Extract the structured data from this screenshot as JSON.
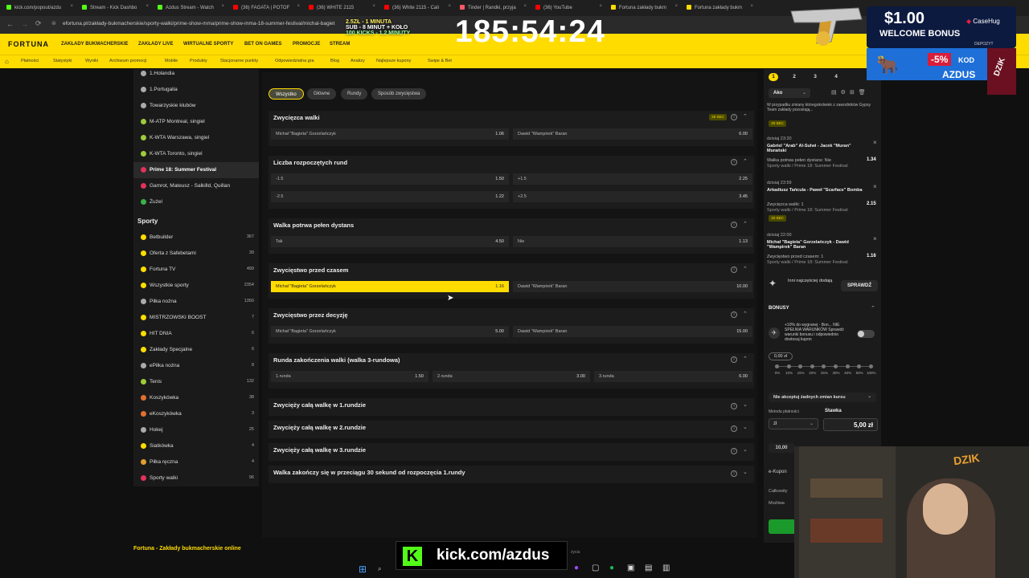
{
  "browser": {
    "tabs": [
      {
        "label": "kick.com/popout/azdu",
        "color": "#53fc18"
      },
      {
        "label": "Stream - Kick Dashbo",
        "color": "#53fc18"
      },
      {
        "label": "Azdus Stream - Watch",
        "color": "#53fc18"
      },
      {
        "label": "(36) FAGATA | POTOF",
        "color": "#ff0000"
      },
      {
        "label": "(36) WHITE 2115",
        "color": "#ff0000"
      },
      {
        "label": "(36) White 2115 - Cali",
        "color": "#ff0000"
      },
      {
        "label": "Tinder | Randki, przyja",
        "color": "#ff5864"
      },
      {
        "label": "(36) YouTube",
        "color": "#ff0000"
      },
      {
        "label": "Fortuna zakłady bukm",
        "color": "#ffdc00"
      },
      {
        "label": "Fortuna zakłady bukm",
        "color": "#ffdc00"
      }
    ],
    "url": "efortuna.pl/zakłady-bukmacherskie/sporty-walki/prime-show-mma/prime-show-mma-18-summer-festival/michal-bagiet"
  },
  "site": {
    "logo": "FORTUNA",
    "nav": [
      "ZAKŁADY BUKMACHERSKIE",
      "ZAKŁADY LIVE",
      "WIRTUALNE SPORTY",
      "BET ON GAMES",
      "PROMOCJE",
      "STREAM"
    ],
    "subnav": [
      "Płatności",
      "Statystyki",
      "Wyniki",
      "Archiwum promocji",
      "Mobile",
      "Produkty",
      "Stacjonarne punkty",
      "Odpowiedzialna gra",
      "Blog",
      "Analizy",
      "Najlepsze kupony",
      "Swipe & Bet"
    ]
  },
  "sidebar": {
    "top_items": [
      {
        "label": "1.Holandia",
        "icon": "soccer-ball",
        "color": "#aaaaaa"
      },
      {
        "label": "1.Portugalia",
        "icon": "soccer-ball",
        "color": "#aaaaaa"
      },
      {
        "label": "Towarzyskie klubów",
        "icon": "soccer-ball",
        "color": "#aaaaaa"
      },
      {
        "label": "M-ATP Montreal, singiel",
        "icon": "tennis-ball",
        "color": "#9ccc3a"
      },
      {
        "label": "K-WTA Warszawa, singiel",
        "icon": "tennis-ball",
        "color": "#9ccc3a"
      },
      {
        "label": "K-WTA Toronto, singiel",
        "icon": "tennis-ball",
        "color": "#9ccc3a"
      },
      {
        "label": "Prime 18: Summer Festival",
        "icon": "fight-glove",
        "color": "#e0325a",
        "selected": true
      },
      {
        "label": "Gamrot, Mateusz - Salkilld, Quillan",
        "icon": "fight-glove",
        "color": "#e0325a"
      },
      {
        "label": "Żużel",
        "icon": "speedway",
        "color": "#3ab24a"
      }
    ],
    "section_title": "Sporty",
    "sports": [
      {
        "label": "Betbuilder",
        "count": "367",
        "color": "#ffdc00"
      },
      {
        "label": "Oferta z Safebetami",
        "count": "39",
        "color": "#ffdc00"
      },
      {
        "label": "Fortuna TV",
        "count": "499",
        "color": "#ffdc00"
      },
      {
        "label": "Wszystkie sporty",
        "count": "2354",
        "color": "#ffdc00"
      },
      {
        "label": "Piłka nożna",
        "count": "1350",
        "color": "#aaaaaa"
      },
      {
        "label": "MISTRZOWSKI BOOST",
        "count": "7",
        "color": "#ffdc00"
      },
      {
        "label": "HIT DNIA",
        "count": "6",
        "color": "#ffdc00"
      },
      {
        "label": "Zakłady Specjalne",
        "count": "6",
        "color": "#ffdc00"
      },
      {
        "label": "ePiłka nożna",
        "count": "8",
        "color": "#aaaaaa"
      },
      {
        "label": "Tenis",
        "count": "132",
        "color": "#9ccc3a"
      },
      {
        "label": "Koszykówka",
        "count": "38",
        "color": "#e07030"
      },
      {
        "label": "eKoszykówka",
        "count": "3",
        "color": "#e07030"
      },
      {
        "label": "Hokej",
        "count": "25",
        "color": "#aaaaaa"
      },
      {
        "label": "Siatkówka",
        "count": "4",
        "color": "#ffdc00"
      },
      {
        "label": "Piłka ręczna",
        "count": "4",
        "color": "#e0a030"
      },
      {
        "label": "Sporty walki",
        "count": "96",
        "color": "#e0325a"
      }
    ]
  },
  "filters": [
    "Wszystko",
    "Główne",
    "Rundy",
    "Sposób zwycięstwa"
  ],
  "markets": {
    "m1": {
      "title": "Zwycięzca walki",
      "badge": "20 SEC",
      "a_name": "Michał \"Bagieta\" Gorzelańczyk",
      "a_odd": "1.06",
      "b_name": "Dawid \"Wampirek\" Baran",
      "b_odd": "6.00"
    },
    "m2": {
      "title": "Liczba rozpoczętych rund",
      "r1a": "-1.5",
      "r1a_odd": "1.50",
      "r1b": "+1.5",
      "r1b_odd": "2.25",
      "r2a": "-2.5",
      "r2a_odd": "1.22",
      "r2b": "+2.5",
      "r2b_odd": "3.45"
    },
    "m3": {
      "title": "Walka potrwa pełen dystans",
      "a_name": "Tak",
      "a_odd": "4.50",
      "b_name": "Nie",
      "b_odd": "1.13"
    },
    "m4": {
      "title": "Zwycięstwo przed czasem",
      "a_name": "Michał \"Bagieta\" Gorzelańczyk",
      "a_odd": "1.16",
      "b_name": "Dawid \"Wampirek\" Baran",
      "b_odd": "10.00"
    },
    "m5": {
      "title": "Zwycięstwo przez decyzję",
      "a_name": "Michał \"Bagieta\" Gorzelańczyk",
      "a_odd": "5.00",
      "b_name": "Dawid \"Wampirek\" Baran",
      "b_odd": "15.00"
    },
    "m6": {
      "title": "Runda zakończenia walki (walka 3-rundowa)",
      "a_name": "1.runda",
      "a_odd": "1.50",
      "b_name": "2.runda",
      "b_odd": "3.00",
      "c_name": "3.runda",
      "c_odd": "6.00"
    },
    "collapsed": [
      "Zwycięży całą walkę w 1.rundzie",
      "Zwycięży całą walkę w 2.rundzie",
      "Zwycięży całą walkę w 3.rundzie",
      "Walka zakończy się w przeciągu 30 sekund od rozpoczęcia 1.rundy"
    ]
  },
  "betslip": {
    "tabs": [
      "1",
      "2",
      "3",
      "4"
    ],
    "type": "Ako",
    "notice": "W przypadku zmiany któregokolwiek z zawodników Gypsy Team zakłady pozostają...",
    "notice_badge": "20 SEC",
    "bets": [
      {
        "time": "dzisiaj 23:20",
        "match": "Gabriel \"Arab\" Al-Sulwi - Jacek \"Muran\" Murański",
        "market": "Walka potrwa pełen dystans: Nie",
        "event": "Sporty walki / Prime 18: Summer Festival",
        "odd": "1.34"
      },
      {
        "time": "dzisiaj 23:59",
        "match": "Arkadiusz Tańcula - Paweł \"Scarface\" Bomba",
        "market": "Zwycięzca walki: 1",
        "event": "Sporty walki / Prime 18: Summer Festival",
        "odd": "2.15",
        "badge": "20 SEC"
      },
      {
        "time": "dzisiaj 22:00",
        "match": "Michał \"Bagieta\" Gorzelańczyk - Dawid \"Wampirek\" Baran",
        "market": "Zwycięstwo przed czasem: 1",
        "event": "Sporty walki / Prime 18: Summer Festival",
        "odd": "1.16"
      }
    ],
    "check_text": "Inni najczęściej dodają",
    "check_button": "SPRAWDŹ",
    "bonus_title": "BONUSY",
    "bonus_text": "+10% do wygranej - Bon... NIE SPEŁNIA WARUNKÓW Sprawdź warunki bonusu i odpowiednio dostosuj kupon",
    "bonus_amount": "0,00 zł",
    "slider_labels": [
      "0%",
      "10%",
      "15%",
      "20%",
      "25%",
      "30%",
      "40%",
      "50%",
      "100%"
    ],
    "accept": "Nie akceptuj żadnych zmian kursu",
    "payment_label": "Metoda płatności",
    "payment_value": "zł",
    "stake_label": "Stawka",
    "stake_value": "5,00 zł",
    "quick": "10,00",
    "ekupon": "e-Kupon",
    "total": "Całkowity",
    "possible": "Możliwa"
  },
  "overlay": {
    "timer": "185:54:24",
    "lines": [
      "2.5ZŁ - 1 MINUTA",
      "SUB - 8 MINUT + KOŁO",
      "100 KICKS - 1.2 MINUTY"
    ],
    "ad_title": "$1.00",
    "ad_sub": "WELCOME BONUS",
    "ad_brand": "CaseHug",
    "ad_tag": "DEPOZYT",
    "ad_discount": "-5%",
    "ad_kod": "KOD",
    "ad_code": "AZDUS",
    "ad_logo": "DZIK",
    "kick_url": "kick.com/azdus",
    "kick_tag": "życia",
    "webcam_logo": "DZIK",
    "footer": "Fortuna - Zakłady bukmacherskie online"
  }
}
